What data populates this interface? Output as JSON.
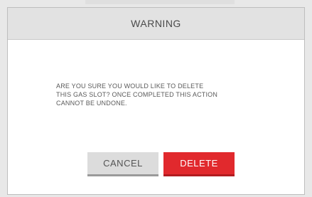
{
  "dialog": {
    "title": "WARNING",
    "message": "ARE YOU SURE YOU WOULD LIKE TO DELETE\nTHIS GAS SLOT? ONCE COMPLETED THIS ACTION\nCANNOT BE UNDONE.",
    "cancel_label": "CANCEL",
    "delete_label": "DELETE"
  },
  "colors": {
    "header_bg": "#e2e2e2",
    "cancel_bg": "#dcdcdc",
    "delete_bg": "#e1292d"
  }
}
